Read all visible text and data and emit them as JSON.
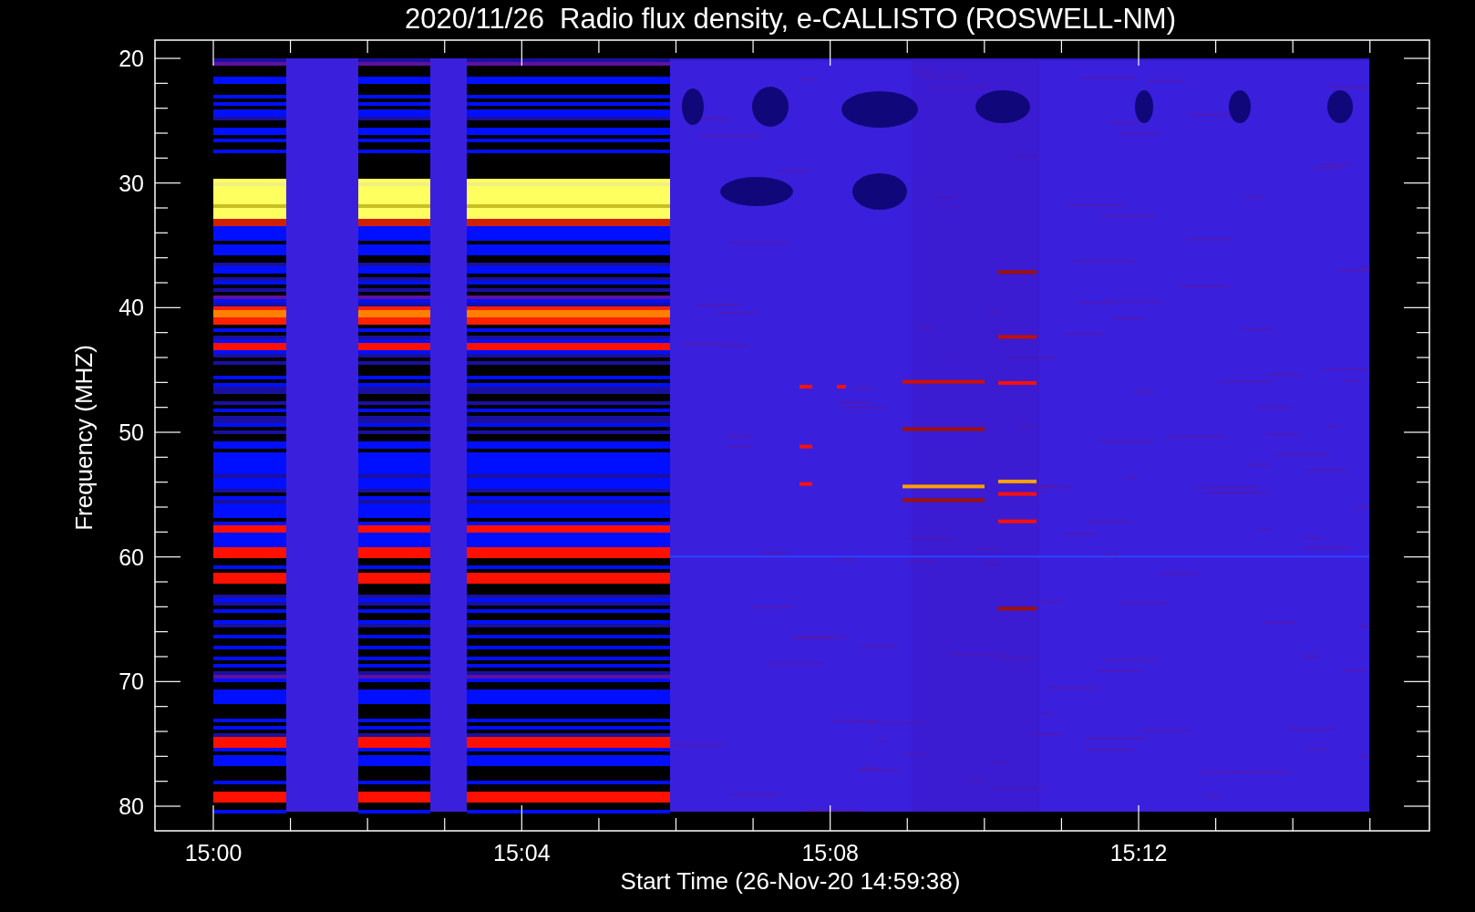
{
  "plot": {
    "title": "2020/11/26  Radio flux density, e-CALLISTO (ROSWELL-NM)",
    "xlabel": "Start Time (26-Nov-20 14:59:38)",
    "ylabel": "Frequency (MHZ)",
    "yticks": [
      "20",
      "30",
      "40",
      "50",
      "60",
      "70",
      "80"
    ],
    "xticks": [
      "15:00",
      "15:04",
      "15:08",
      "15:12"
    ]
  }
}
